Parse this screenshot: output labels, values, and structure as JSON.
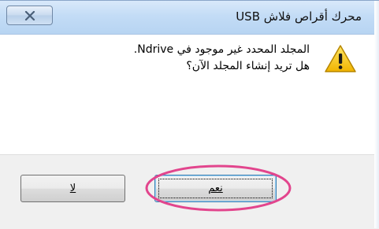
{
  "window": {
    "title": "محرك أقراص فلاش USB"
  },
  "titlebar": {
    "close_icon": "close-x-icon"
  },
  "message": {
    "icon": "warning-triangle-icon",
    "line1": "المجلد المحدد غير موجود في Ndrive.",
    "line2": "هل تريد إنشاء المجلد الآن؟"
  },
  "buttons": {
    "yes_label": "نعم",
    "no_label": "لا"
  },
  "annotation": {
    "highlight_color": "#e2458d"
  },
  "colors": {
    "titlebar_bg": "#c3dcf6",
    "footer_bg": "#f0f0f0",
    "warning_yellow": "#f5c400"
  }
}
